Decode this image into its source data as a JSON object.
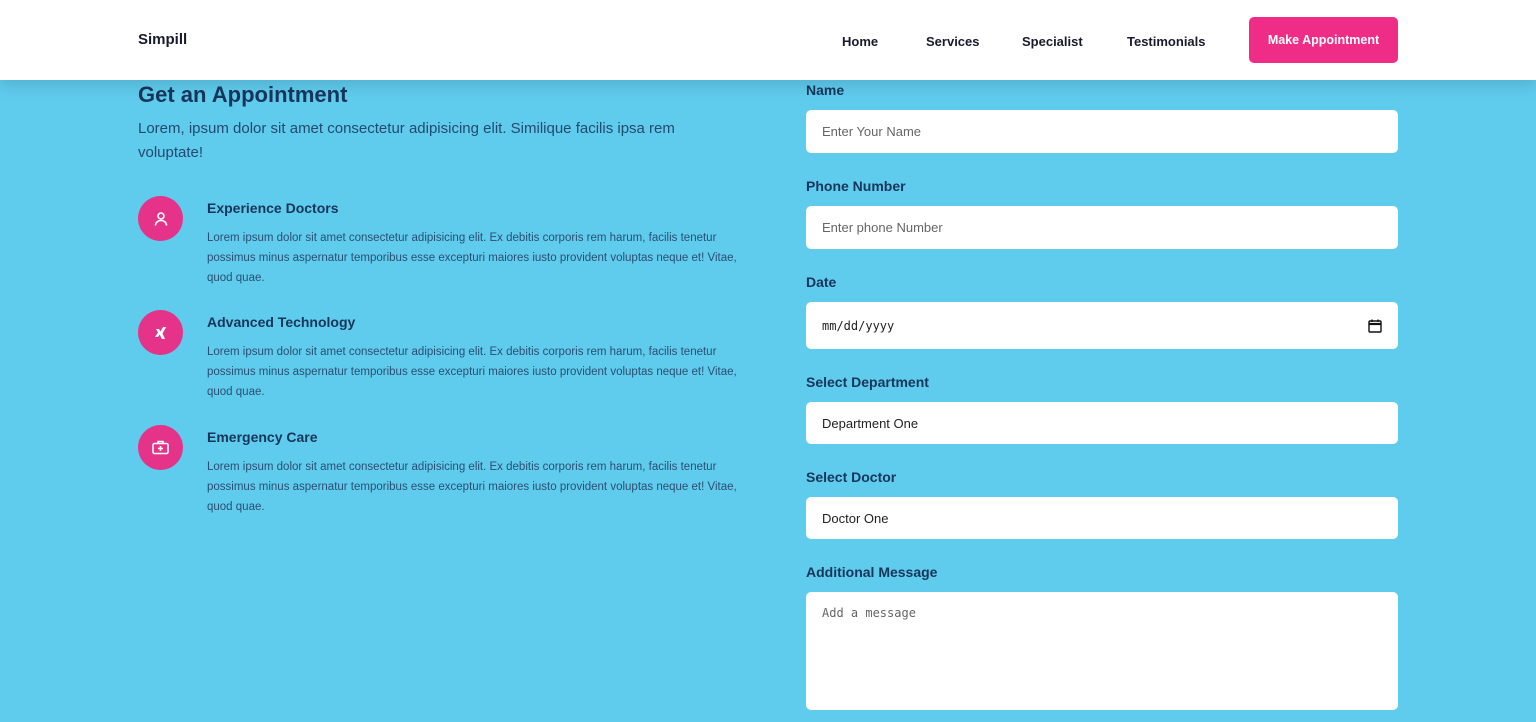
{
  "header": {
    "brand": "Simpill",
    "nav": [
      "Home",
      "Services",
      "Specialist",
      "Testimonials"
    ],
    "cta_label": "Make Appointment",
    "accent_color": "#ef2d87"
  },
  "left": {
    "heading": "Get an Appointment",
    "intro": "Lorem, ipsum dolor sit amet consectetur adipisicing elit. Similique facilis ipsa rem voluptate!",
    "features": [
      {
        "icon": "user-icon",
        "title": "Experience Doctors",
        "text": "Lorem ipsum dolor sit amet consectetur adipisicing elit. Ex debitis corporis rem harum, facilis tenetur possimus minus aspernatur temporibus esse excepturi maiores iusto provident voluptas neque et! Vitae, quod quae."
      },
      {
        "icon": "xing-icon",
        "title": "Advanced Technology",
        "text": "Lorem ipsum dolor sit amet consectetur adipisicing elit. Ex debitis corporis rem harum, facilis tenetur possimus minus aspernatur temporibus esse excepturi maiores iusto provident voluptas neque et! Vitae, quod quae."
      },
      {
        "icon": "first-aid-kit-icon",
        "title": "Emergency Care",
        "text": "Lorem ipsum dolor sit amet consectetur adipisicing elit. Ex debitis corporis rem harum, facilis tenetur possimus minus aspernatur temporibus esse excepturi maiores iusto provident voluptas neque et! Vitae, quod quae."
      }
    ]
  },
  "form": {
    "name_label": "Name",
    "name_placeholder": "Enter Your Name",
    "phone_label": "Phone Number",
    "phone_placeholder": "Enter phone Number",
    "date_label": "Date",
    "date_placeholder": "mm/dd/yyyy",
    "department_label": "Select Department",
    "department_value": "Department One",
    "doctor_label": "Select Doctor",
    "doctor_value": "Doctor One",
    "message_label": "Additional Message",
    "message_placeholder": "Add a message"
  }
}
